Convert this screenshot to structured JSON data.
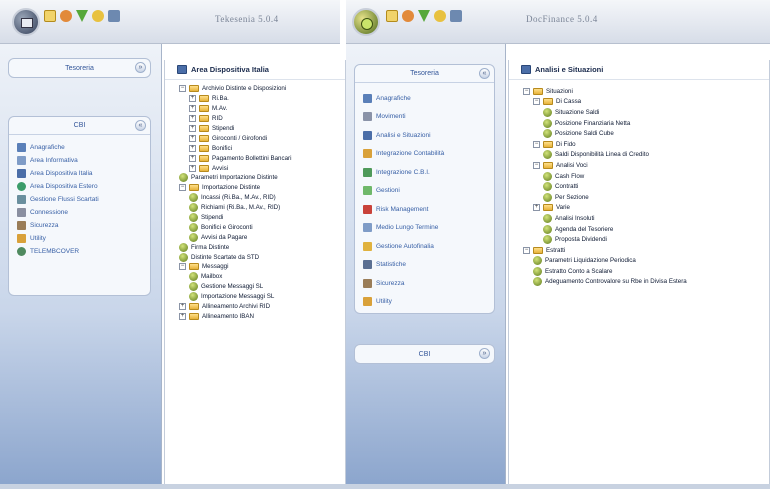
{
  "left_window": {
    "title": "Tekesenia 5.0.4",
    "toolbar_icons": [
      "folder-icon",
      "search-icon",
      "filter-icon",
      "star-icon",
      "users-icon"
    ],
    "sidebar": {
      "panel_top_label": "Tesoreria",
      "panel_label": "CBI",
      "items": [
        {
          "label": "Anagrafiche",
          "icon": "registry-icon"
        },
        {
          "label": "Area Informativa",
          "icon": "info-icon"
        },
        {
          "label": "Area Dispositiva Italia",
          "icon": "italy-area-icon"
        },
        {
          "label": "Area Dispositiva Estero",
          "icon": "globe-icon"
        },
        {
          "label": "Gestione Flussi Scartati",
          "icon": "flows-icon"
        },
        {
          "label": "Connessione",
          "icon": "connection-icon"
        },
        {
          "label": "Sicurezza",
          "icon": "security-icon"
        },
        {
          "label": "Utility",
          "icon": "utility-icon"
        },
        {
          "label": "TELEMBCOVER",
          "icon": "telem-icon"
        }
      ]
    },
    "tree": {
      "title": "Area Dispositiva Italia",
      "nodes": [
        {
          "level": 0,
          "toggle": "−",
          "type": "folder",
          "label": "Archivio Distinte e Disposizioni"
        },
        {
          "level": 1,
          "toggle": "+",
          "type": "folder",
          "label": "Ri.Ba."
        },
        {
          "level": 1,
          "toggle": "+",
          "type": "folder",
          "label": "M.Av."
        },
        {
          "level": 1,
          "toggle": "+",
          "type": "folder",
          "label": "RID"
        },
        {
          "level": 1,
          "toggle": "+",
          "type": "folder",
          "label": "Stipendi"
        },
        {
          "level": 1,
          "toggle": "+",
          "type": "folder",
          "label": "Giroconti / Girofondi"
        },
        {
          "level": 1,
          "toggle": "+",
          "type": "folder",
          "label": "Bonifici"
        },
        {
          "level": 1,
          "toggle": "+",
          "type": "folder",
          "label": "Pagamento Bollettini Bancari"
        },
        {
          "level": 1,
          "toggle": "+",
          "type": "folder",
          "label": "Avvisi"
        },
        {
          "level": 0,
          "toggle": "",
          "type": "runner",
          "label": "Parametri Importazione Distinte"
        },
        {
          "level": 0,
          "toggle": "−",
          "type": "folder",
          "label": "Importazione Distinte"
        },
        {
          "level": 1,
          "toggle": "",
          "type": "runner",
          "label": "Incassi (Ri.Ba., M.Av., RID)"
        },
        {
          "level": 1,
          "toggle": "",
          "type": "runner",
          "label": "Richiami (Ri.Ba., M.Av., RID)"
        },
        {
          "level": 1,
          "toggle": "",
          "type": "runner",
          "label": "Stipendi"
        },
        {
          "level": 1,
          "toggle": "",
          "type": "runner",
          "label": "Bonifici e Giroconti"
        },
        {
          "level": 1,
          "toggle": "",
          "type": "runner",
          "label": "Avvisi da Pagare"
        },
        {
          "level": 0,
          "toggle": "",
          "type": "runner",
          "label": "Firma Distinte"
        },
        {
          "level": 0,
          "toggle": "",
          "type": "runner",
          "label": "Distinte Scartate da STD"
        },
        {
          "level": 0,
          "toggle": "−",
          "type": "folder",
          "label": "Messaggi"
        },
        {
          "level": 1,
          "toggle": "",
          "type": "runner",
          "label": "Mailbox"
        },
        {
          "level": 1,
          "toggle": "",
          "type": "runner",
          "label": "Gestione Messaggi SL"
        },
        {
          "level": 1,
          "toggle": "",
          "type": "runner",
          "label": "Importazione Messaggi SL"
        },
        {
          "level": 0,
          "toggle": "+",
          "type": "folder",
          "label": "Allineamento Archivi RID"
        },
        {
          "level": 0,
          "toggle": "+",
          "type": "folder",
          "label": "Allineamento IBAN"
        }
      ]
    }
  },
  "right_window": {
    "title": "DocFinance 5.0.4",
    "toolbar_icons": [
      "folder-icon",
      "search-icon",
      "filter-icon",
      "star-icon",
      "users-icon"
    ],
    "sidebar": {
      "panel_label": "Tesoreria",
      "items": [
        {
          "label": "Anagrafiche",
          "icon": "registry-icon"
        },
        {
          "label": "Movimenti",
          "icon": "movements-icon"
        },
        {
          "label": "Analisi e Situazioni",
          "icon": "analysis-icon"
        },
        {
          "label": "Integrazione Contabilità",
          "icon": "accounting-icon"
        },
        {
          "label": "Integrazione C.B.I.",
          "icon": "cbi-icon"
        },
        {
          "label": "Gestioni",
          "icon": "management-icon"
        },
        {
          "label": "Risk Management",
          "icon": "risk-icon"
        },
        {
          "label": "Medio Lungo Termine",
          "icon": "long-term-icon"
        },
        {
          "label": "Gestione Autofinalia",
          "icon": "auto-icon"
        },
        {
          "label": "Statistiche",
          "icon": "stats-icon"
        },
        {
          "label": "Sicurezza",
          "icon": "security-icon"
        },
        {
          "label": "Utility",
          "icon": "utility-icon"
        }
      ],
      "panel_bottom_label": "CBI"
    },
    "tree": {
      "title": "Analisi e Situazioni",
      "nodes": [
        {
          "level": 0,
          "toggle": "−",
          "type": "folder",
          "label": "Situazioni"
        },
        {
          "level": 1,
          "toggle": "−",
          "type": "folder",
          "label": "Di Cassa"
        },
        {
          "level": 2,
          "toggle": "",
          "type": "runner",
          "label": "Situazione Saldi"
        },
        {
          "level": 2,
          "toggle": "",
          "type": "runner",
          "label": "Posizione Finanziaria Netta"
        },
        {
          "level": 2,
          "toggle": "",
          "type": "runner",
          "label": "Posizione Saldi Cube"
        },
        {
          "level": 1,
          "toggle": "−",
          "type": "folder",
          "label": "Di Fido"
        },
        {
          "level": 2,
          "toggle": "",
          "type": "runner",
          "label": "Saldi Disponibilità Linea di Credito"
        },
        {
          "level": 1,
          "toggle": "−",
          "type": "folder",
          "label": "Analisi Voci"
        },
        {
          "level": 2,
          "toggle": "",
          "type": "runner",
          "label": "Cash Flow"
        },
        {
          "level": 2,
          "toggle": "",
          "type": "runner",
          "label": "Contratti"
        },
        {
          "level": 2,
          "toggle": "",
          "type": "runner",
          "label": "Per Sezione"
        },
        {
          "level": 1,
          "toggle": "+",
          "type": "folder",
          "label": "Varie"
        },
        {
          "level": 2,
          "toggle": "",
          "type": "runner",
          "label": "Analisi Insoluti"
        },
        {
          "level": 2,
          "toggle": "",
          "type": "runner",
          "label": "Agenda del Tesoriere"
        },
        {
          "level": 2,
          "toggle": "",
          "type": "runner",
          "label": "Proposta Dividendi"
        },
        {
          "level": 0,
          "toggle": "−",
          "type": "folder",
          "label": "Estratti"
        },
        {
          "level": 1,
          "toggle": "",
          "type": "runner",
          "label": "Parametri Liquidazione Periodica"
        },
        {
          "level": 1,
          "toggle": "",
          "type": "runner",
          "label": "Estratto Conto a Scalare"
        },
        {
          "level": 1,
          "toggle": "",
          "type": "runner",
          "label": "Adeguamento Controvalore su Rbe in Divisa Estera"
        }
      ]
    }
  },
  "colors": {
    "sidebar_text": "#3860a6",
    "tree_text": "#0e1a33",
    "folder": "#e7b33a",
    "sidebar_bg_bottom": "#8aa4cc"
  }
}
